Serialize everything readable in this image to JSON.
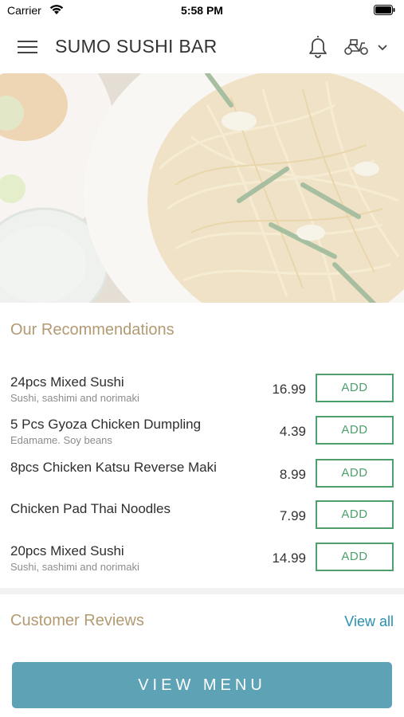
{
  "status_bar": {
    "carrier": "Carrier",
    "time": "5:58 PM"
  },
  "header": {
    "title": "SUMO SUSHI BAR",
    "icons": [
      "menu-icon",
      "bell-icon",
      "scooter-icon",
      "chevron-down-icon"
    ]
  },
  "recommendations": {
    "title": "Our Recommendations",
    "add_label": "ADD",
    "items": [
      {
        "name": "24pcs Mixed Sushi",
        "description": "Sushi, sashimi and norimaki",
        "price": "16.99"
      },
      {
        "name": "5 Pcs Gyoza Chicken Dumpling",
        "description": "Edamame. Soy beans",
        "price": "4.39"
      },
      {
        "name": "8pcs Chicken Katsu Reverse Maki",
        "description": "",
        "price": "8.99"
      },
      {
        "name": "Chicken Pad Thai Noodles",
        "description": "",
        "price": "7.99"
      },
      {
        "name": "20pcs Mixed Sushi",
        "description": "Sushi, sashimi and norimaki",
        "price": "14.99"
      }
    ]
  },
  "reviews": {
    "title": "Customer Reviews",
    "view_all": "View all"
  },
  "cta": {
    "label": "VIEW MENU"
  },
  "colors": {
    "accent_gold": "#b29a72",
    "add_green": "#4da06b",
    "link_blue": "#2a8fb0",
    "button_teal": "#5ea2b5"
  }
}
